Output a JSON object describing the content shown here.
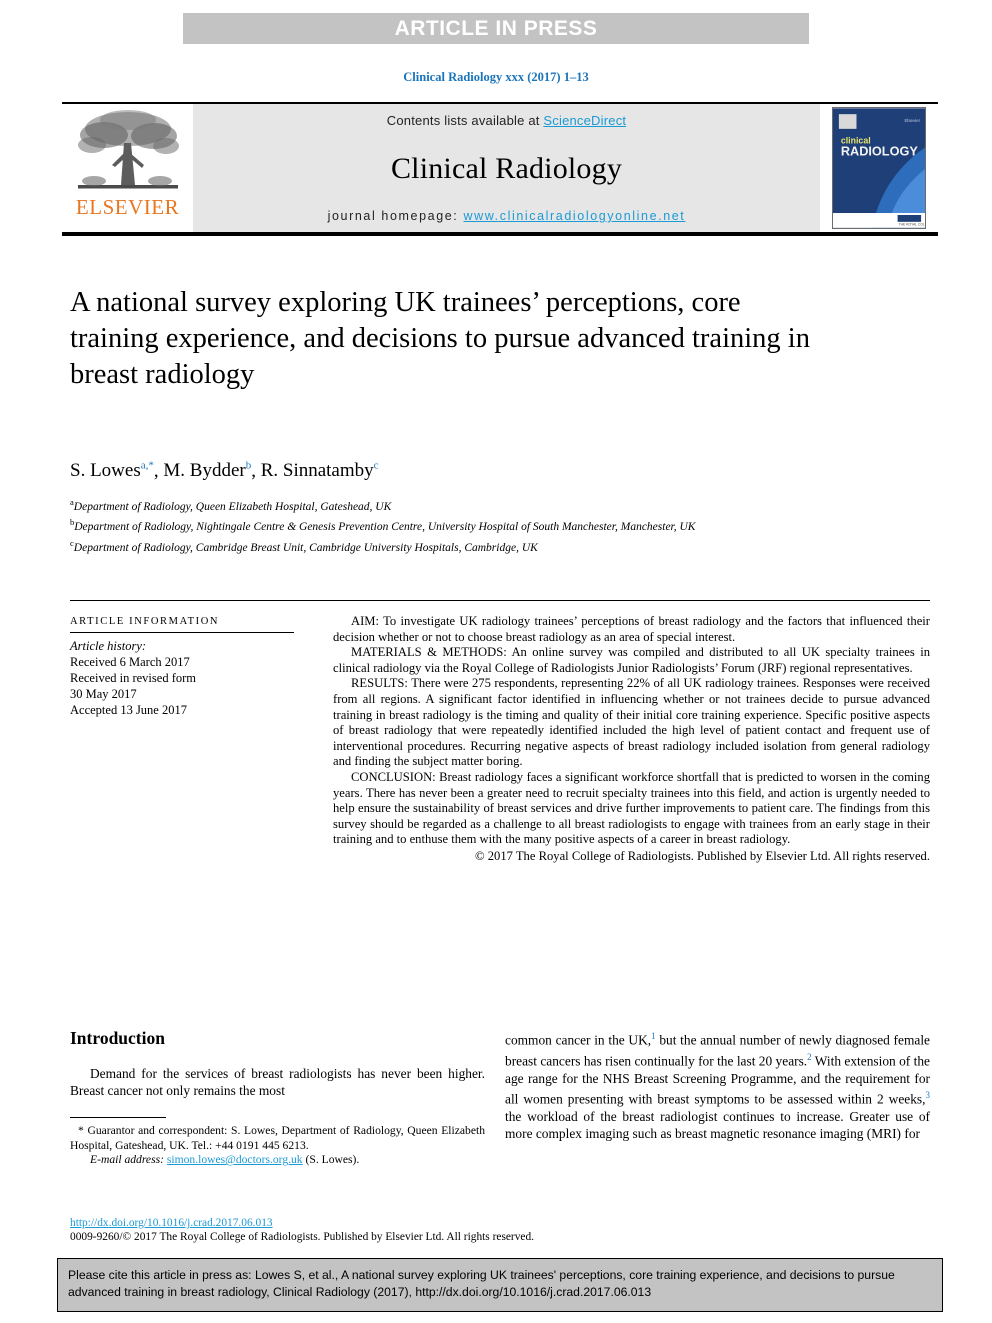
{
  "banner": {
    "label": "ARTICLE IN PRESS",
    "bg_color": "#c3c3c3",
    "text_color": "#ffffff"
  },
  "running_head": {
    "text": "Clinical Radiology xxx (2017) 1–13",
    "color": "#1b75bb"
  },
  "masthead": {
    "publisher_name": "ELSEVIER",
    "publisher_color": "#e87722",
    "contents_prefix": "Contents lists available at ",
    "contents_link": "ScienceDirect",
    "journal_name": "Clinical Radiology",
    "homepage_prefix": "journal homepage: ",
    "homepage_link": "www.clinicalradiologyonline.net",
    "link_color": "#1b9ad6",
    "cover_title_small": "clinical",
    "cover_title_large": "RADIOLOGY",
    "cover_bg_color": "#1e3f78"
  },
  "article": {
    "title": "A national survey exploring UK trainees’ perceptions, core training experience, and decisions to pursue advanced training in breast radiology",
    "authors": [
      {
        "name": "S. Lowes",
        "sup": "a",
        "star": true
      },
      {
        "name": "M. Bydder",
        "sup": "b",
        "star": false
      },
      {
        "name": "R. Sinnatamby",
        "sup": "c",
        "star": false
      }
    ],
    "affiliations": [
      {
        "marker": "a",
        "text": "Department of Radiology, Queen Elizabeth Hospital, Gateshead, UK"
      },
      {
        "marker": "b",
        "text": "Department of Radiology, Nightingale Centre & Genesis Prevention Centre, University Hospital of South Manchester, Manchester, UK"
      },
      {
        "marker": "c",
        "text": "Department of Radiology, Cambridge Breast Unit, Cambridge University Hospitals, Cambridge, UK"
      }
    ]
  },
  "article_information": {
    "heading": "ARTICLE INFORMATION",
    "history_label": "Article history:",
    "history": [
      "Received 6 March 2017",
      "Received in revised form",
      "30 May 2017",
      "Accepted 13 June 2017"
    ]
  },
  "abstract": {
    "aim_label": "AIM:",
    "aim_text": " To investigate UK radiology trainees’ perceptions of breast radiology and the factors that influenced their decision whether or not to choose breast radiology as an area of special interest.",
    "methods_label": "MATERIALS & METHODS:",
    "methods_text": " An online survey was compiled and distributed to all UK specialty trainees in clinical radiology via the Royal College of Radiologists Junior Radiologists’ Forum (JRF) regional representatives.",
    "results_label": "RESULTS:",
    "results_text": " There were 275 respondents, representing 22% of all UK radiology trainees. Responses were received from all regions. A significant factor identified in influencing whether or not trainees decide to pursue advanced training in breast radiology is the timing and quality of their initial core training experience. Specific positive aspects of breast radiology that were repeatedly identified included the high level of patient contact and frequent use of interventional procedures. Recurring negative aspects of breast radiology included isolation from general radiology and finding the subject matter boring.",
    "conclusion_label": "CONCLUSION:",
    "conclusion_text": " Breast radiology faces a significant workforce shortfall that is predicted to worsen in the coming years. There has never been a greater need to recruit specialty trainees into this field, and action is urgently needed to help ensure the sustainability of breast services and drive further improvements to patient care. The findings from this survey should be regarded as a challenge to all breast radiologists to engage with trainees from an early stage in their training and to enthuse them with the many positive aspects of a career in breast radiology.",
    "copyright": "© 2017 The Royal College of Radiologists. Published by Elsevier Ltd. All rights reserved."
  },
  "body": {
    "introduction_heading": "Introduction",
    "left_paragraph": "Demand for the services of breast radiologists has never been higher. Breast cancer not only remains the most",
    "right_paragraph_parts": [
      {
        "text": "common cancer in the UK,"
      },
      {
        "sup": "1"
      },
      {
        "text": " but the annual number of newly diagnosed female breast cancers has risen continually for the last 20 years."
      },
      {
        "sup": "2"
      },
      {
        "text": " With extension of the age range for the NHS Breast Screening Programme, and the requirement for all women presenting with breast symptoms to be assessed within 2 weeks,"
      },
      {
        "sup": "3"
      },
      {
        "text": " the workload of the breast radiologist continues to increase. Greater use of more complex imaging such as breast magnetic resonance imaging (MRI) for"
      }
    ]
  },
  "footnotes": {
    "correspondence": "* Guarantor and correspondent: S. Lowes, Department of Radiology, Queen Elizabeth Hospital, Gateshead, UK. Tel.: +44 0191 445 6213.",
    "email_label": "E-mail address:",
    "email_link": "simon.lowes@doctors.org.uk",
    "email_suffix": " (S. Lowes).",
    "doi_url": "http://dx.doi.org/10.1016/j.crad.2017.06.013",
    "issn_line": "0009-9260/© 2017 The Royal College of Radiologists. Published by Elsevier Ltd. All rights reserved."
  },
  "citation_box": {
    "text": "Please cite this article in press as: Lowes S, et al., A national survey exploring UK trainees' perceptions, core training experience, and decisions to pursue advanced training in breast radiology, Clinical Radiology (2017), http://dx.doi.org/10.1016/j.crad.2017.06.013",
    "bg_color": "#c3c3c3"
  }
}
